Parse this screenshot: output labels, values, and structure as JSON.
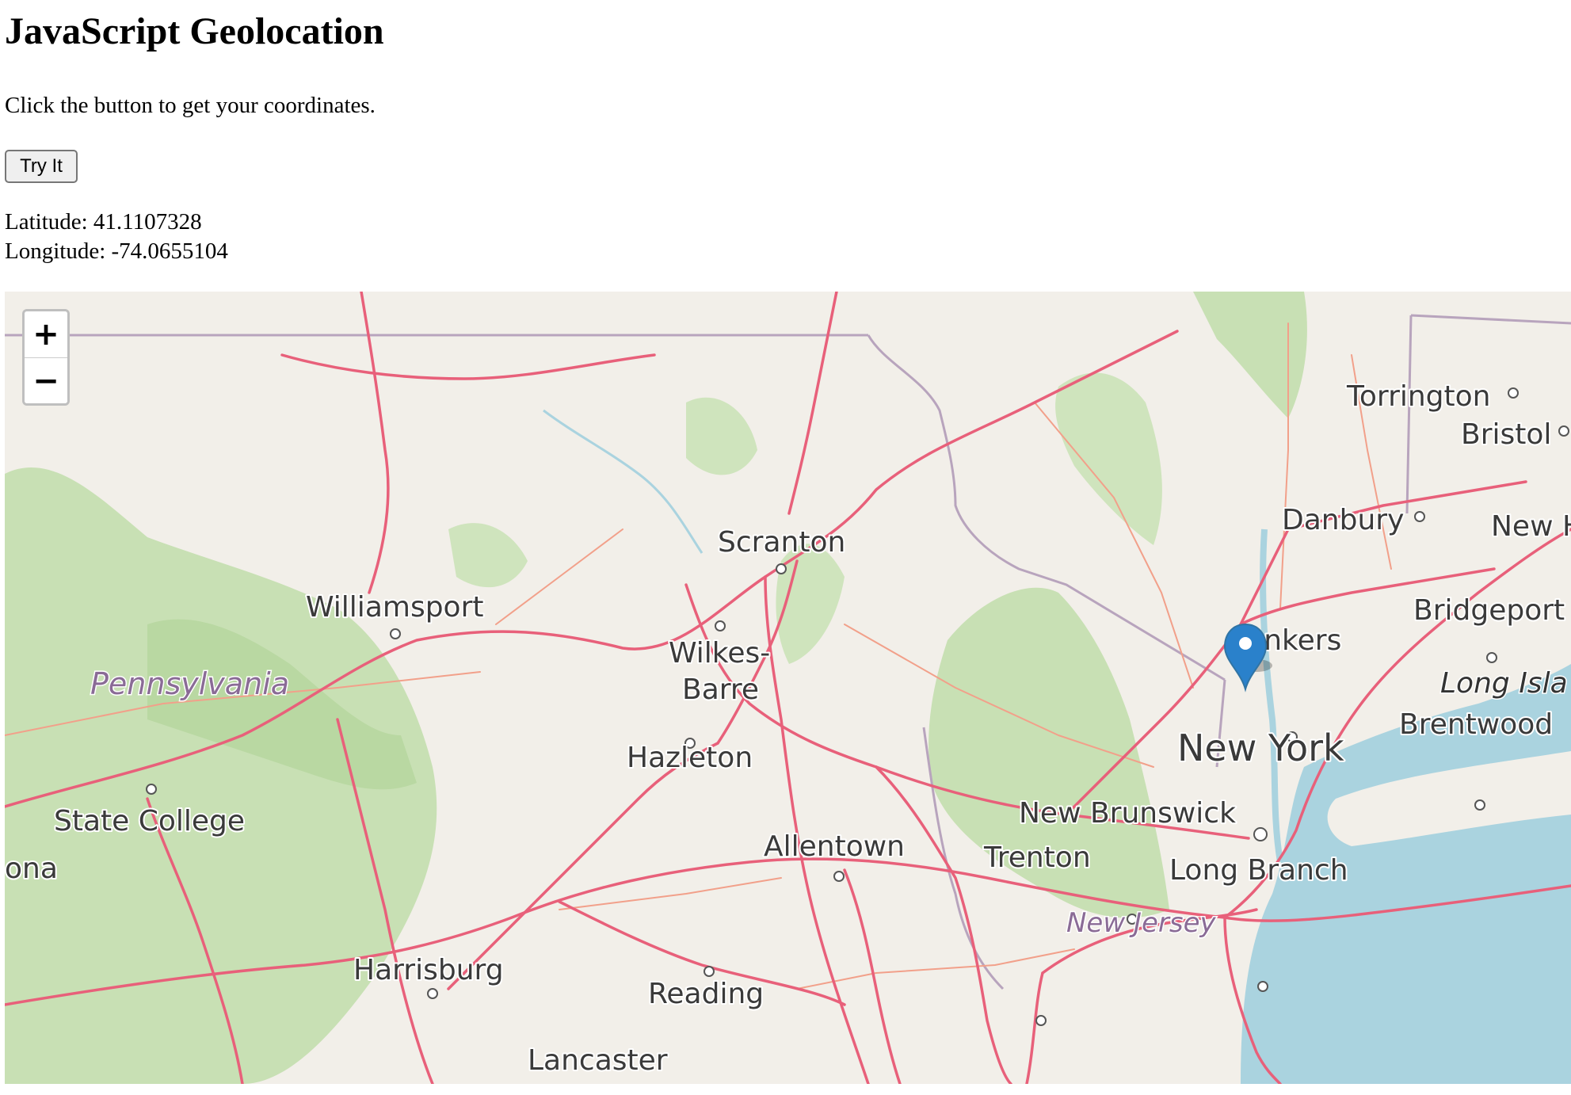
{
  "page": {
    "title": "JavaScript Geolocation",
    "instructions": "Click the button to get your coordinates.",
    "button_label": "Try It"
  },
  "coordinates": {
    "latitude_line": "Latitude: 41.1107328",
    "longitude_line": "Longitude: -74.0655104"
  },
  "map": {
    "zoom_in": "+",
    "zoom_out": "−",
    "marker_icon": "map-marker-icon",
    "colors": {
      "land": "#f2efe9",
      "forest": "#c8e0b4",
      "water": "#aad3df",
      "major_road": "#e8607a",
      "minor_road": "#f2a08a",
      "marker": "#2a81cb"
    },
    "labels": {
      "pennsylvania": "Pennsylvania",
      "scranton": "Scranton",
      "williamsport": "Williamsport",
      "wilkes": "Wilkes-",
      "barre": "Barre",
      "hazleton": "Hazleton",
      "state_college": "State College",
      "altoona_partial": "ona",
      "allentown": "Allentown",
      "harrisburg": "Harrisburg",
      "reading": "Reading",
      "lancaster": "Lancaster",
      "torrington": "Torrington",
      "bristol": "Bristol",
      "danbury": "Danbury",
      "new_haven_partial": "New H",
      "bridgeport": "Bridgeport",
      "yonkers": "Yonkers",
      "long_island": "Long Isla",
      "brentwood": "Brentwood",
      "new_york": "New York",
      "new_brunswick": "New Brunswick",
      "trenton": "Trenton",
      "long_branch": "Long Branch",
      "new_jersey": "New Jersey"
    }
  }
}
